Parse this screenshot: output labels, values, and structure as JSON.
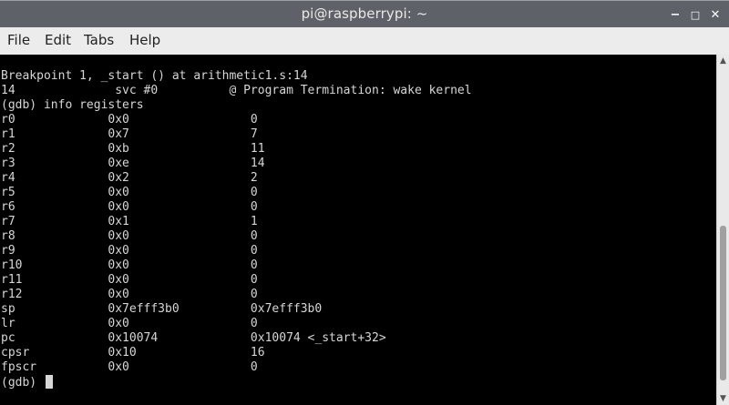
{
  "window": {
    "title": "pi@raspberrypi: ~",
    "controls": {
      "minimize": "−",
      "maximize": "□",
      "close": "✕"
    }
  },
  "menu": {
    "items": [
      "File",
      "Edit",
      "Tabs",
      "Help"
    ]
  },
  "terminal": {
    "lines": [
      "Breakpoint 1, _start () at arithmetic1.s:14",
      "14\t\tsvc #0\t\t@ Program Termination: wake kernel",
      "(gdb) info registers",
      "r0             0x0                 0",
      "r1             0x7                 7",
      "r2             0xb                 11",
      "r3             0xe                 14",
      "r4             0x2                 2",
      "r5             0x0                 0",
      "r6             0x0                 0",
      "r7             0x1                 1",
      "r8             0x0                 0",
      "r9             0x0                 0",
      "r10            0x0                 0",
      "r11            0x0                 0",
      "r12            0x0                 0",
      "sp             0x7efff3b0          0x7efff3b0",
      "lr             0x0                 0",
      "pc             0x10074             0x10074 <_start+32>",
      "cpsr           0x10                16",
      "fpscr          0x0                 0"
    ],
    "prompt": "(gdb) "
  },
  "colors": {
    "titlebar": "#5e6268",
    "menubar": "#ececec",
    "terminal_bg": "#000000",
    "terminal_fg": "#d6d6d6"
  }
}
